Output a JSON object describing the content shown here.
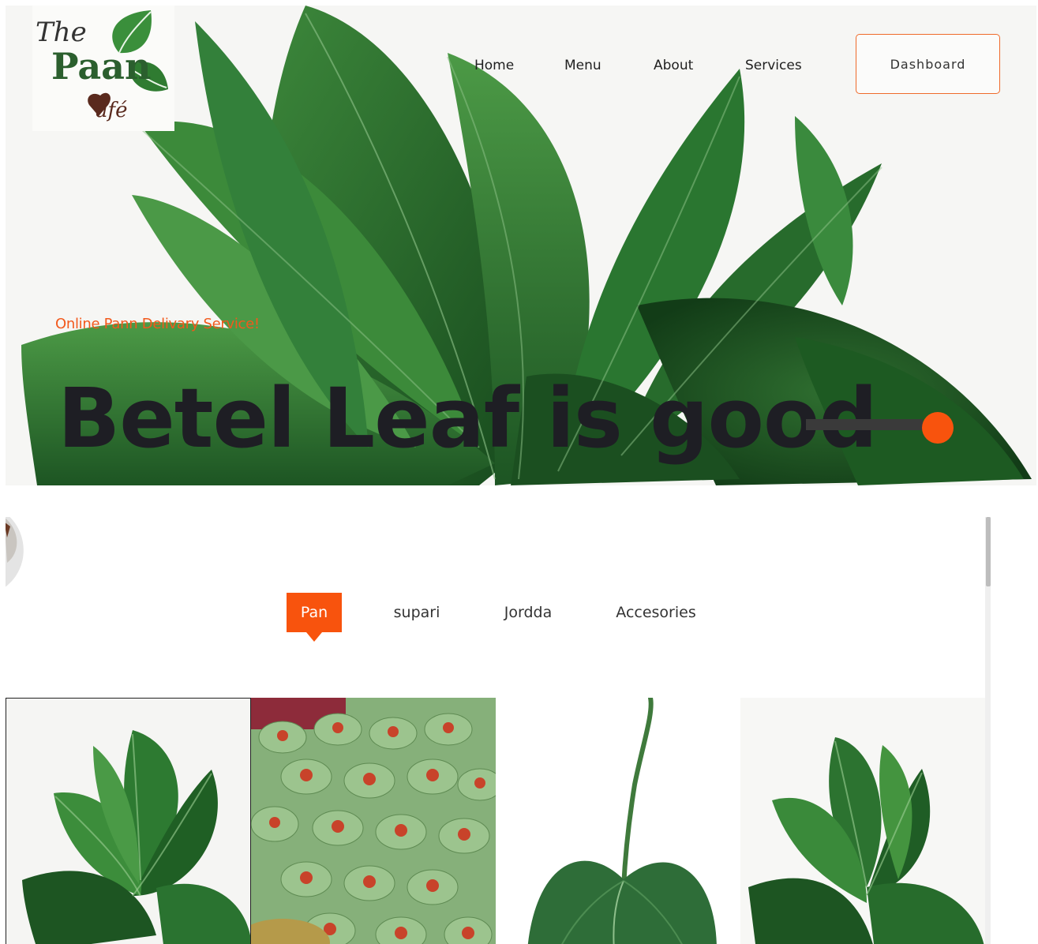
{
  "header": {
    "logo": {
      "line1": "The",
      "line2": "Paan",
      "line3": "afé"
    },
    "nav": [
      {
        "label": "Home"
      },
      {
        "label": "Menu"
      },
      {
        "label": "About"
      },
      {
        "label": "Services"
      }
    ],
    "dashboard_label": "Dashboard"
  },
  "hero": {
    "tagline": "Online Pann Delivary Service!",
    "headline": "Betel Leaf is good"
  },
  "products": {
    "tabs": [
      {
        "label": "Pan",
        "active": true
      },
      {
        "label": "supari",
        "active": false
      },
      {
        "label": "Jordda",
        "active": false
      },
      {
        "label": "Accesories",
        "active": false
      }
    ]
  },
  "colors": {
    "accent": "#f8530d",
    "tagline": "#f2591c",
    "leaf_dark": "#1f5a24",
    "leaf_mid": "#2f7a33",
    "headline": "#1e1e24"
  }
}
